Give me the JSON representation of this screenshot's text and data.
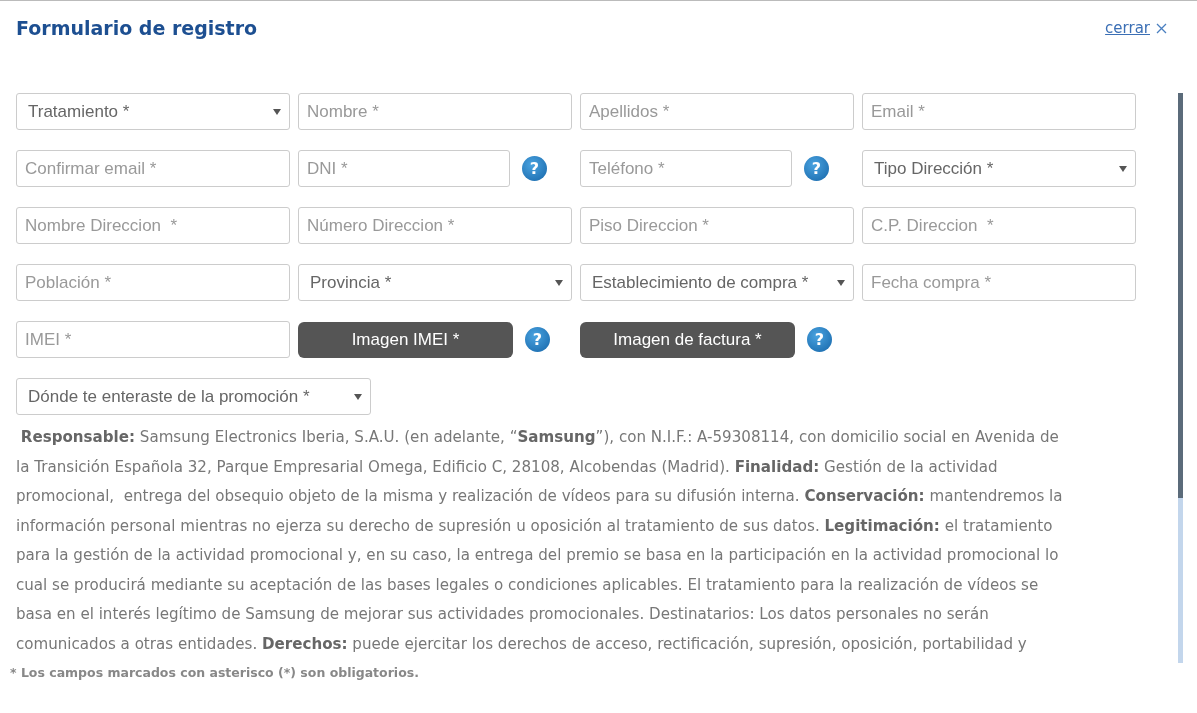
{
  "dialog": {
    "title": "Formulario de registro",
    "close_link": "cerrar"
  },
  "form_rows": [
    [
      {
        "kind": "select",
        "label": "Tratamiento *"
      },
      {
        "kind": "input",
        "placeholder": "Nombre *"
      },
      {
        "kind": "input",
        "placeholder": "Apellidos *"
      },
      {
        "kind": "input",
        "placeholder": "Email *"
      }
    ],
    [
      {
        "kind": "input",
        "placeholder": "Confirmar email *"
      },
      {
        "kind": "input",
        "placeholder": "DNI *",
        "help": "?"
      },
      {
        "kind": "input",
        "placeholder": "Teléfono *",
        "help": "?"
      },
      {
        "kind": "select",
        "label": "Tipo Dirección *"
      }
    ],
    [
      {
        "kind": "input",
        "placeholder": "Nombre Direccion  *"
      },
      {
        "kind": "input",
        "placeholder": "Número Direccion *"
      },
      {
        "kind": "input",
        "placeholder": "Piso Direccion *"
      },
      {
        "kind": "input",
        "placeholder": "C.P. Direccion  *"
      }
    ],
    [
      {
        "kind": "input",
        "placeholder": "Población *"
      },
      {
        "kind": "select",
        "label": "Provincia *"
      },
      {
        "kind": "select",
        "label": "Establecimiento de compra *"
      },
      {
        "kind": "input",
        "placeholder": "Fecha compra *"
      }
    ],
    [
      {
        "kind": "input",
        "placeholder": "IMEI *"
      },
      {
        "kind": "upload",
        "label": "Imagen IMEI *",
        "help": "?"
      },
      {
        "kind": "upload",
        "label": "Imagen de factura *",
        "help": "?"
      }
    ],
    [
      {
        "kind": "select",
        "label": "Dónde te enteraste de la promoción *"
      }
    ]
  ],
  "legal_text": " **Responsable:** Samsung Electronics Iberia, S.A.U. (en adelante, “**Samsung**”), con N.I.F.: A-59308114, con domicilio social en Avenida de la Transición Española 32, Parque Empresarial Omega, Edificio C, 28108, Alcobendas (Madrid). **Finalidad:** Gestión de la actividad promocional,  entrega del obsequio objeto de la misma y realización de vídeos para su difusión interna. **Conservación:** mantendremos la información personal mientras no ejerza su derecho de supresión u oposición al tratamiento de sus datos. **Legitimación:** el tratamiento para la gestión de la actividad promocional y, en su caso, la entrega del premio se basa en la participación en la actividad promocional lo cual se producirá mediante su aceptación de las bases legales o condiciones aplicables. El tratamiento para la realización de vídeos se basa en el interés legítimo de Samsung de mejorar sus actividades promocionales. Destinatarios: Los datos personales no serán comunicados a otras entidades. **Derechos:** puede ejercitar los derechos de acceso, rectificación, supresión, oposición, portabilidad y",
  "required_note": "* Los campos marcados con asterisco (*) son obligatorios."
}
